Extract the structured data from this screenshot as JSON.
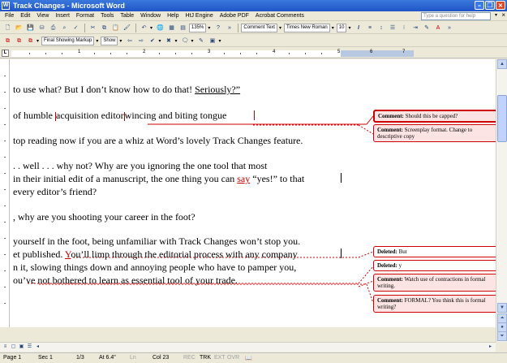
{
  "window": {
    "title": "Track Changes - Microsoft Word",
    "icon": "W"
  },
  "menu": {
    "items": [
      "File",
      "Edit",
      "View",
      "Insert",
      "Format",
      "Tools",
      "Table",
      "Window",
      "Help",
      "HtJ Engine",
      "Adobe PDF",
      "Acrobat Comments"
    ],
    "help_placeholder": "Type a question for help",
    "close_glyph": "×"
  },
  "toolbar1": {
    "zoom": "135%",
    "style": "Comment Text",
    "font": "Times New Roman",
    "size": "10",
    "italic": "I"
  },
  "toolbar2": {
    "display_mode": "Final Showing Markup",
    "show_label": "Show"
  },
  "ruler": {
    "numbers": [
      "1",
      "2",
      "3",
      "4",
      "5",
      "6",
      "7"
    ]
  },
  "document": {
    "line1": {
      "a": "to use what? But I don’t know how to do that! ",
      "b": "Seriously?”"
    },
    "line2": {
      "a": "of humble ",
      "b": "acquisition editor",
      "c": "wincing and biting tongue"
    },
    "line3": "top reading now if you are a whiz at Word’s lovely Track Changes feature.",
    "line4": ". . well . . . why not? Why are you ignoring the one tool that most",
    "line5": {
      "a": "in their initial edit of a manuscript, the one thing you can ",
      "b": "say",
      "c": " “yes!” to that"
    },
    "line6": "every editor’s friend?",
    "line7": ", why are you shooting your career in the foot?",
    "line8": "yourself in the foot, being unfamiliar with Track Changes won’t stop you.",
    "line9": {
      "a": "et published. ",
      "b": "Y",
      "c": "ou’ll limp through the editorial process with any company"
    },
    "line10": "n it, slowing things down and annoying people who have to pamper you,",
    "line11": {
      "a": "ou’ve ",
      "b": "not bothered to learn as essential tool of your trade."
    }
  },
  "balloons": [
    {
      "kind": "Comment:",
      "text": "Should this be capped?"
    },
    {
      "kind": "Comment:",
      "text": "Screenplay format. Change to descriptive copy"
    },
    {
      "kind": "Deleted:",
      "text": "But"
    },
    {
      "kind": "Deleted:",
      "text": "y"
    },
    {
      "kind": "Comment:",
      "text": "Watch use of contractions in formal writing."
    },
    {
      "kind": "Comment:",
      "text": "FORMAL? You think this is formal writing?"
    }
  ],
  "status": {
    "page": "Page 1",
    "section": "Sec 1",
    "pages": "1/3",
    "at": "At 6.4\"",
    "ln": "Ln",
    "col": "Col 23",
    "rec": "REC",
    "trk": "TRK",
    "ext": "EXT",
    "ovr": "OVR"
  },
  "colors": {
    "markup": "#cc0000",
    "balloon_fill": "#fde4e4",
    "titlebar": "#245edb"
  }
}
